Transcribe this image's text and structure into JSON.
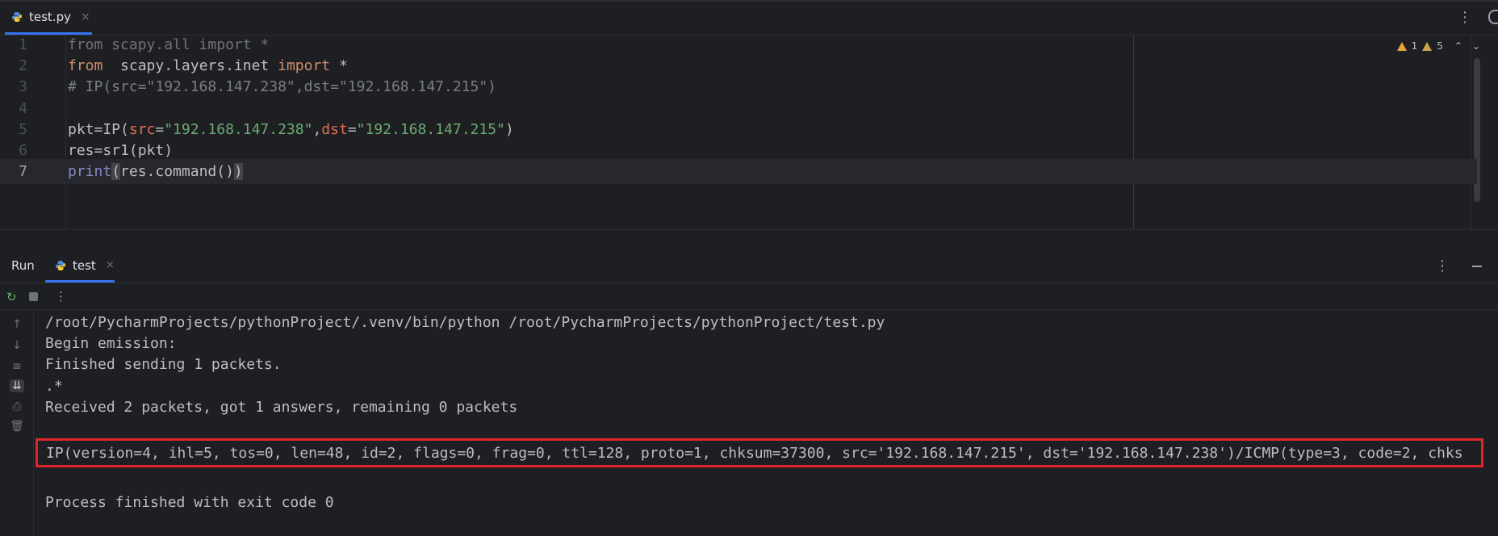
{
  "editor_tab": {
    "label": "test.py",
    "close": "×"
  },
  "inspections": {
    "warnings": "1",
    "weak_warnings": "5"
  },
  "code_lines": [
    {
      "n": "1",
      "parts": [
        [
          "dim",
          "from scapy.all import *"
        ]
      ]
    },
    {
      "n": "2",
      "parts": [
        [
          "kw",
          "from"
        ],
        [
          "",
          "  scapy.layers.inet "
        ],
        [
          "kw",
          "import"
        ],
        [
          "",
          " *"
        ]
      ]
    },
    {
      "n": "3",
      "parts": [
        [
          "comment",
          "# IP(src=\"192.168.147.238\",dst=\"192.168.147.215\")"
        ]
      ]
    },
    {
      "n": "4",
      "parts": []
    },
    {
      "n": "5",
      "parts": [
        [
          "",
          "pkt=IP("
        ],
        [
          "param",
          "src"
        ],
        [
          "",
          "="
        ],
        [
          "str",
          "\"192.168.147.238\""
        ],
        [
          "",
          ","
        ],
        [
          "param",
          "dst"
        ],
        [
          "",
          "="
        ],
        [
          "str",
          "\"192.168.147.215\""
        ],
        [
          "",
          ")"
        ]
      ]
    },
    {
      "n": "6",
      "parts": [
        [
          "",
          "res=sr1(pkt)"
        ]
      ]
    },
    {
      "n": "7",
      "parts": [
        [
          "builtin",
          "print"
        ],
        [
          "bracket",
          "("
        ],
        [
          "",
          "res.command()"
        ],
        [
          "bracket",
          ")"
        ]
      ]
    }
  ],
  "run_panel": {
    "title": "Run",
    "tab_label": "test",
    "close": "×"
  },
  "console_lines": [
    "/root/PycharmProjects/pythonProject/.venv/bin/python /root/PycharmProjects/pythonProject/test.py",
    "Begin emission:",
    "Finished sending 1 packets.",
    ".*",
    "Received 2 packets, got 1 answers, remaining 0 packets"
  ],
  "highlighted_output": "IP(version=4, ihl=5, tos=0, len=48, id=2, flags=0, frag=0, ttl=128, proto=1, chksum=37300, src='192.168.147.215', dst='192.168.147.238')/ICMP(type=3, code=2, chks",
  "exit_message": "Process finished with exit code 0",
  "colors": {
    "highlight_border": "#e0242b",
    "accent": "#3574f0"
  }
}
